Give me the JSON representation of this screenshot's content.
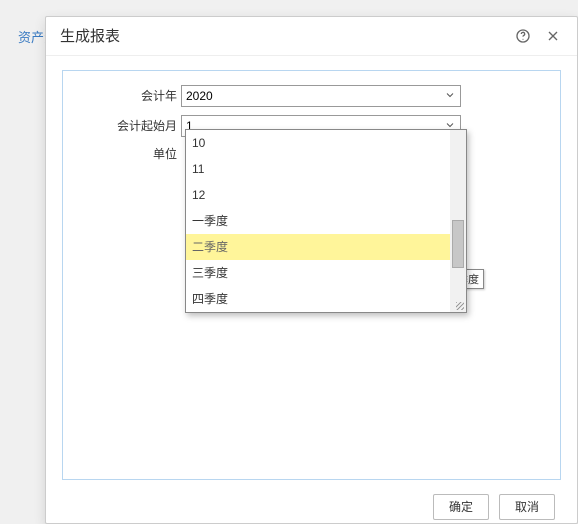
{
  "page": {
    "tab_left": "资产负"
  },
  "dialog": {
    "title": "生成报表",
    "fields": {
      "year_label": "会计年",
      "year_value": "2020",
      "start_month_label": "会计起始月",
      "start_month_value": "1",
      "unit_label": "单位"
    },
    "dropdown_options": [
      "10",
      "11",
      "12",
      "一季度",
      "二季度",
      "三季度",
      "四季度"
    ],
    "highlighted_option": "二季度",
    "tooltip": "二季度",
    "buttons": {
      "ok": "确定",
      "cancel": "取消"
    }
  }
}
